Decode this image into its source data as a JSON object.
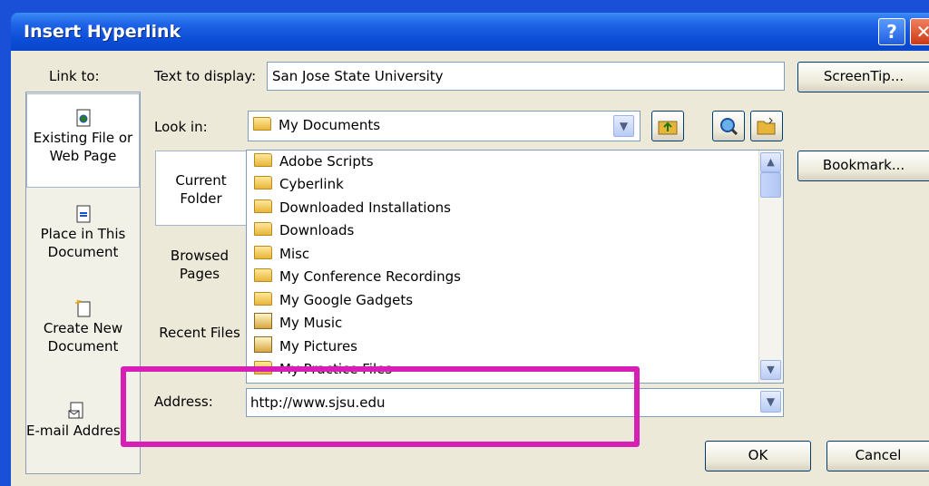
{
  "window": {
    "title": "Insert Hyperlink",
    "help_glyph": "?",
    "close_glyph": "✕"
  },
  "link_to": {
    "label": "Link to:",
    "items": [
      {
        "label": "Existing File or Web Page",
        "icon": "document-globe-icon",
        "selected": true
      },
      {
        "label": "Place in This Document",
        "icon": "document-place-icon",
        "selected": false
      },
      {
        "label": "Create New Document",
        "icon": "new-document-icon",
        "selected": false
      },
      {
        "label": "E-mail Address",
        "icon": "email-icon",
        "selected": false
      }
    ]
  },
  "text_to_display": {
    "label": "Text to display:",
    "value": "San Jose State University"
  },
  "screentip_button": "ScreenTip...",
  "bookmark_button": "Bookmark...",
  "look_in": {
    "label": "Look in:",
    "value": "My Documents"
  },
  "tabs": [
    {
      "label": "Current Folder",
      "selected": true
    },
    {
      "label": "Browsed Pages",
      "selected": false
    },
    {
      "label": "Recent Files",
      "selected": false
    }
  ],
  "files": [
    {
      "name": "Adobe Scripts",
      "type": "folder"
    },
    {
      "name": "Cyberlink",
      "type": "folder"
    },
    {
      "name": "Downloaded Installations",
      "type": "folder"
    },
    {
      "name": "Downloads",
      "type": "folder"
    },
    {
      "name": "Misc",
      "type": "folder"
    },
    {
      "name": "My Conference Recordings",
      "type": "folder"
    },
    {
      "name": "My Google Gadgets",
      "type": "folder"
    },
    {
      "name": "My Music",
      "type": "music-folder"
    },
    {
      "name": "My Pictures",
      "type": "pictures-folder"
    },
    {
      "name": "My Practice Files",
      "type": "folder"
    }
  ],
  "address": {
    "label": "Address:",
    "value": "http://www.sjsu.edu"
  },
  "ok_button": "OK",
  "cancel_button": "Cancel",
  "colors": {
    "highlight": "#d81fb5",
    "titlebar": "#0a4cd6",
    "dialog_bg": "#ece9d8"
  }
}
